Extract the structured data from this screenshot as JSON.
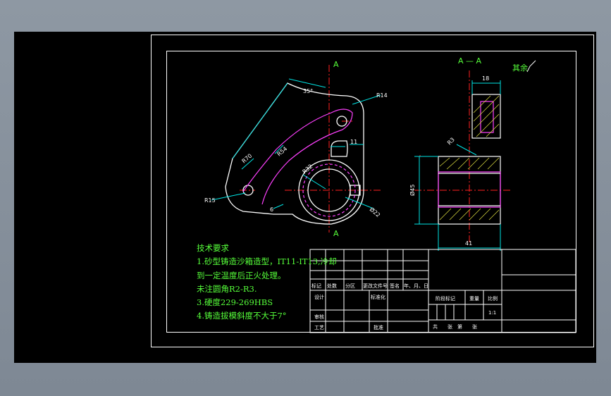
{
  "drawing": {
    "section_labels": {
      "top": "A",
      "bottom": "A",
      "view_title": "A — A"
    },
    "roughness_note": "其余",
    "dimensions": {
      "angle": "35°",
      "r14": "R14",
      "r70": "R70",
      "r54": "R54",
      "r32": "R32",
      "r15": "R15",
      "dia22": "Ø22",
      "six": "6",
      "eleven": "11",
      "eighteen": "18",
      "r3": "R3",
      "dia45": "Ø45",
      "fortyone": "41"
    }
  },
  "notes": {
    "title": "技术要求",
    "line1": "1.砂型铸造沙箱造型，IT11-IT13,冷却",
    "line2": "到一定温度后正火处理。",
    "line3": "未注圆角R2-R3.",
    "line4": "3.硬度229-269HBS",
    "line5": "4.铸造拔模斜度不大于7°"
  },
  "title_block": {
    "row_labels": [
      "标记",
      "处数",
      "分区",
      "更改文件号",
      "签名",
      "年、月、日"
    ],
    "design": "设计",
    "standard": "标准化",
    "review": "审核",
    "process": "工艺",
    "approve": "批准",
    "stage": "阶段标记",
    "weight": "重量",
    "scale_label": "比例",
    "scale_value": "1:1",
    "sheets": "共　　张　第　　张"
  },
  "colors": {
    "background": "#000000",
    "outline": "#ffffff",
    "dimension": "#00e5e5",
    "centerline": "#ff2020",
    "hidden": "#ff40ff",
    "text": "#56ff3a",
    "hatch": "#e0e040"
  }
}
